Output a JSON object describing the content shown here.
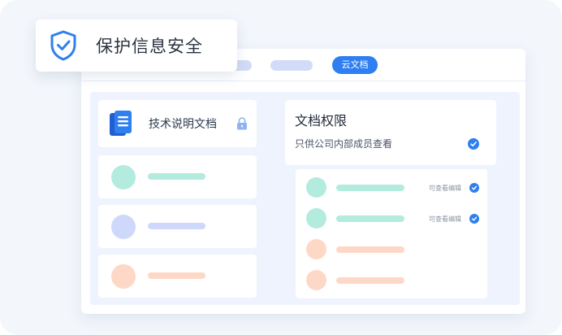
{
  "badge": {
    "text": "保护信息安全",
    "icon": "shield-check-icon",
    "accent": "#2f7ff0"
  },
  "topbar": {
    "active_tab": "云文档"
  },
  "document": {
    "title": "技术说明文档",
    "icon": "document-icon",
    "lock_icon": "lock-icon"
  },
  "permission": {
    "title": "文档权限",
    "option": "只供公司内部成员查看",
    "members": [
      {
        "role": "可查看编辑",
        "checked": true
      },
      {
        "role": "可查看编辑",
        "checked": true
      },
      {
        "role": "",
        "checked": false
      },
      {
        "role": "",
        "checked": false
      }
    ]
  },
  "colors": {
    "accent": "#2f7ff0",
    "teal": "#b3ebdf",
    "blue": "#cdd8fb",
    "peach": "#fed8c6"
  }
}
